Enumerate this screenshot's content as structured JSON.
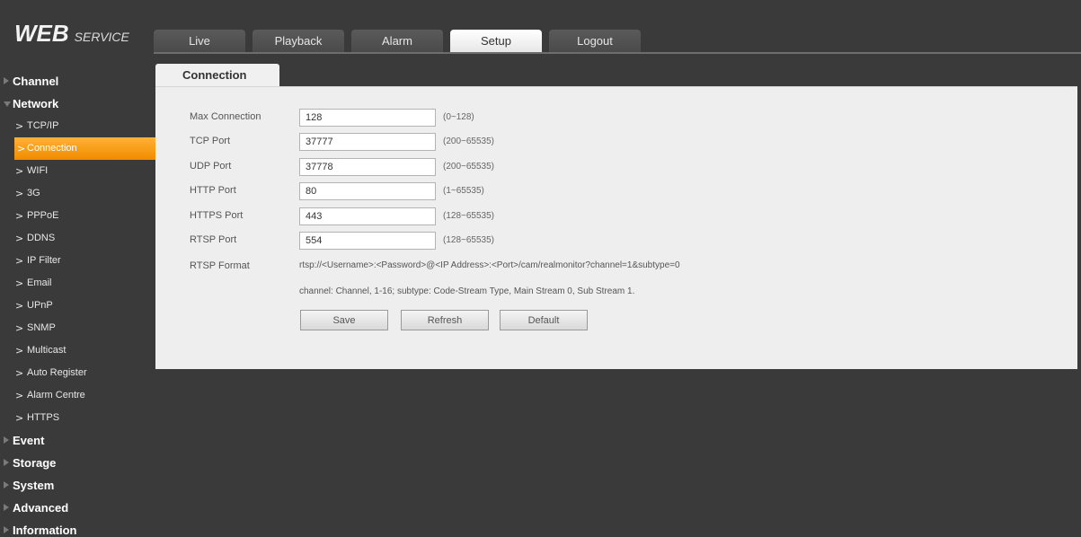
{
  "logo": {
    "main": "WEB",
    "sub": "SERVICE"
  },
  "tabs": [
    {
      "label": "Live"
    },
    {
      "label": "Playback"
    },
    {
      "label": "Alarm"
    },
    {
      "label": "Setup"
    },
    {
      "label": "Logout"
    }
  ],
  "active_tab": "Setup",
  "sidebar": {
    "channel": "Channel",
    "network": "Network",
    "network_items": [
      "TCP/IP",
      "Connection",
      "WIFI",
      "3G",
      "PPPoE",
      "DDNS",
      "IP Filter",
      "Email",
      "UPnP",
      "SNMP",
      "Multicast",
      "Auto Register",
      "Alarm Centre",
      "HTTPS"
    ],
    "event": "Event",
    "storage": "Storage",
    "system": "System",
    "advanced": "Advanced",
    "information": "Information"
  },
  "content": {
    "tab_label": "Connection",
    "fields": [
      {
        "label": "Max Connection",
        "value": "128",
        "range": "(0~128)"
      },
      {
        "label": "TCP Port",
        "value": "37777",
        "range": "(200~65535)"
      },
      {
        "label": "UDP Port",
        "value": "37778",
        "range": "(200~65535)"
      },
      {
        "label": "HTTP Port",
        "value": "80",
        "range": "(1~65535)"
      },
      {
        "label": "HTTPS Port",
        "value": "443",
        "range": "(128~65535)"
      },
      {
        "label": "RTSP Port",
        "value": "554",
        "range": "(128~65535)"
      }
    ],
    "rtsp_format_label": "RTSP Format",
    "rtsp_format_value": "rtsp://<Username>:<Password>@<IP Address>:<Port>/cam/realmonitor?channel=1&subtype=0",
    "note": "channel: Channel, 1-16; subtype: Code-Stream Type, Main Stream 0, Sub Stream 1.",
    "buttons": {
      "save": "Save",
      "refresh": "Refresh",
      "default": "Default"
    }
  },
  "colors": {
    "background": "#3a3a3a",
    "panel": "#eeeeee",
    "active_item": "#f5a000"
  }
}
